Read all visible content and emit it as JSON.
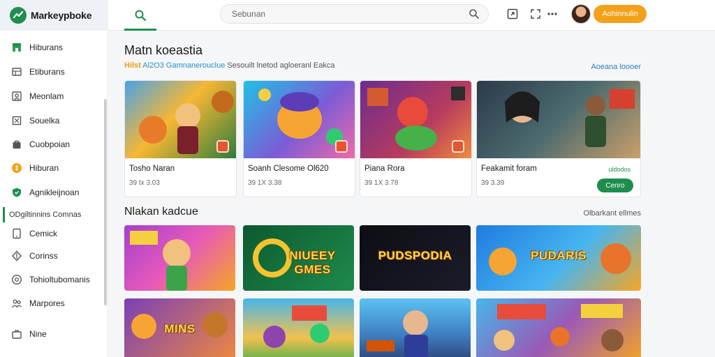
{
  "brand": {
    "name": "Markeypboke"
  },
  "search": {
    "placeholder": "Sebunan"
  },
  "header": {
    "action_label": "Aohinnulin"
  },
  "sidebar": {
    "items": [
      {
        "label": "Hiburans",
        "icon": "store-icon"
      },
      {
        "label": "Etiburans",
        "icon": "grid-icon"
      },
      {
        "label": "Meonlam",
        "icon": "users-icon"
      },
      {
        "label": "Souelka",
        "icon": "box-icon"
      },
      {
        "label": "Cuobpoian",
        "icon": "bag-icon"
      },
      {
        "label": "Hiburan",
        "icon": "coin-icon"
      },
      {
        "label": "Agnikleijnoan",
        "icon": "shield-icon"
      }
    ],
    "section_label": "ODgiltinnins Comnas",
    "items2": [
      {
        "label": "Cemick",
        "icon": "tablet-icon"
      },
      {
        "label": "Corinss",
        "icon": "diamond-icon"
      },
      {
        "label": "Tohioltubomanis",
        "icon": "target-icon"
      },
      {
        "label": "Marpores",
        "icon": "people-icon"
      },
      {
        "label": "Nine",
        "icon": "briefcase-icon"
      }
    ]
  },
  "main": {
    "heading": "Matn koeastia",
    "sub_tag": "Hilst",
    "sub_highlight": "Al2O3 Gamnanerouclue",
    "sub_rest": "Sesouilt lnetod agloeranl Eakca",
    "link_right": "Aoeana loooer",
    "cards": [
      {
        "title": "Tosho Naran",
        "sub": "39 tx 3.03"
      },
      {
        "title": "Soanh Clesome Ol620",
        "sub": "39 1X 3.38"
      },
      {
        "title": "Piana Rora",
        "sub": "39 1X 3.78"
      },
      {
        "title": "Feakamit foram",
        "sub": "39 3.39",
        "label": "uldodos",
        "button": "Cenro"
      }
    ],
    "section2_heading": "Nlakan kadcue",
    "section2_link": "Olbarkant ellmes",
    "tiles": [
      {
        "text": ""
      },
      {
        "text": "NIUEEY GMES"
      },
      {
        "text": "PUDSPODIA"
      },
      {
        "text": "PUDARIS"
      },
      {
        "text": "MINS"
      },
      {
        "text": ""
      },
      {
        "text": ""
      },
      {
        "text": ""
      }
    ]
  }
}
